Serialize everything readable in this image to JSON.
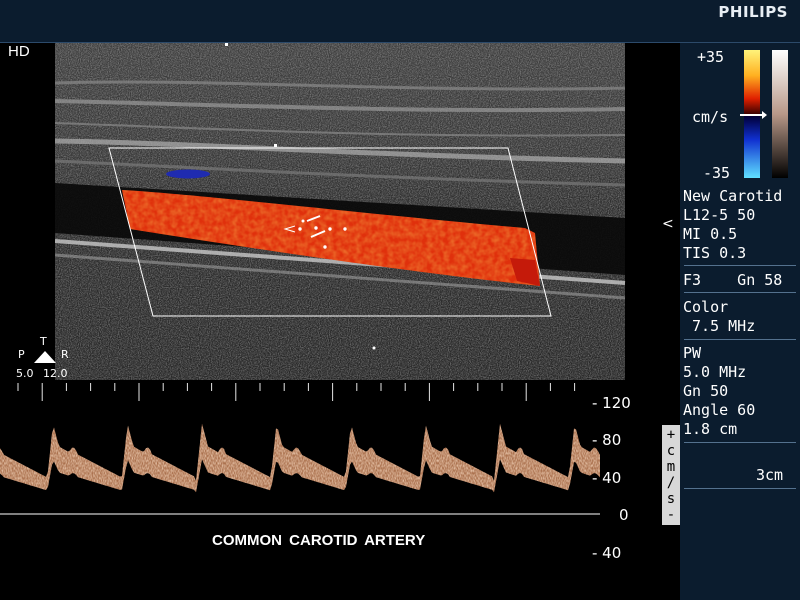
{
  "header": {
    "brand": "PHILIPS"
  },
  "image_mode": {
    "label": "HD"
  },
  "color_scale": {
    "max": "+35",
    "min": "-35",
    "unit": "cm/s"
  },
  "transducer_orientation": {
    "p": "P",
    "t": "T",
    "r": "R",
    "near": "5.0",
    "far": "12.0"
  },
  "side_marker": "<",
  "settings": {
    "preset": "New Carotid",
    "probe": "L12-5 50",
    "mi": "MI 0.5",
    "tis": "TIS 0.3",
    "freq_gain": "F3    Gn 58",
    "color_label": "Color",
    "color_freq": " 7.5 MHz",
    "pw_label": "PW",
    "pw_freq": "5.0 MHz",
    "pw_gain": "Gn 50",
    "pw_angle": "Angle 60",
    "pw_depth": "1.8 cm",
    "scale_depth": "3cm"
  },
  "doppler": {
    "scale_labels": [
      "- 120",
      "- 80",
      "- 40",
      "0",
      "- 40"
    ],
    "scale_values": [
      120,
      80,
      40,
      0,
      -40
    ],
    "unit_vertical": [
      "+",
      "c",
      "m",
      "/",
      "s",
      "-"
    ]
  },
  "caption": "COMMON CAROTID ARTERY",
  "colors": {
    "panel": "#0b1c2e",
    "flow_red": "#e8380f",
    "flow_blue": "#1f2bb0",
    "spectrum": "#e8b48a"
  }
}
